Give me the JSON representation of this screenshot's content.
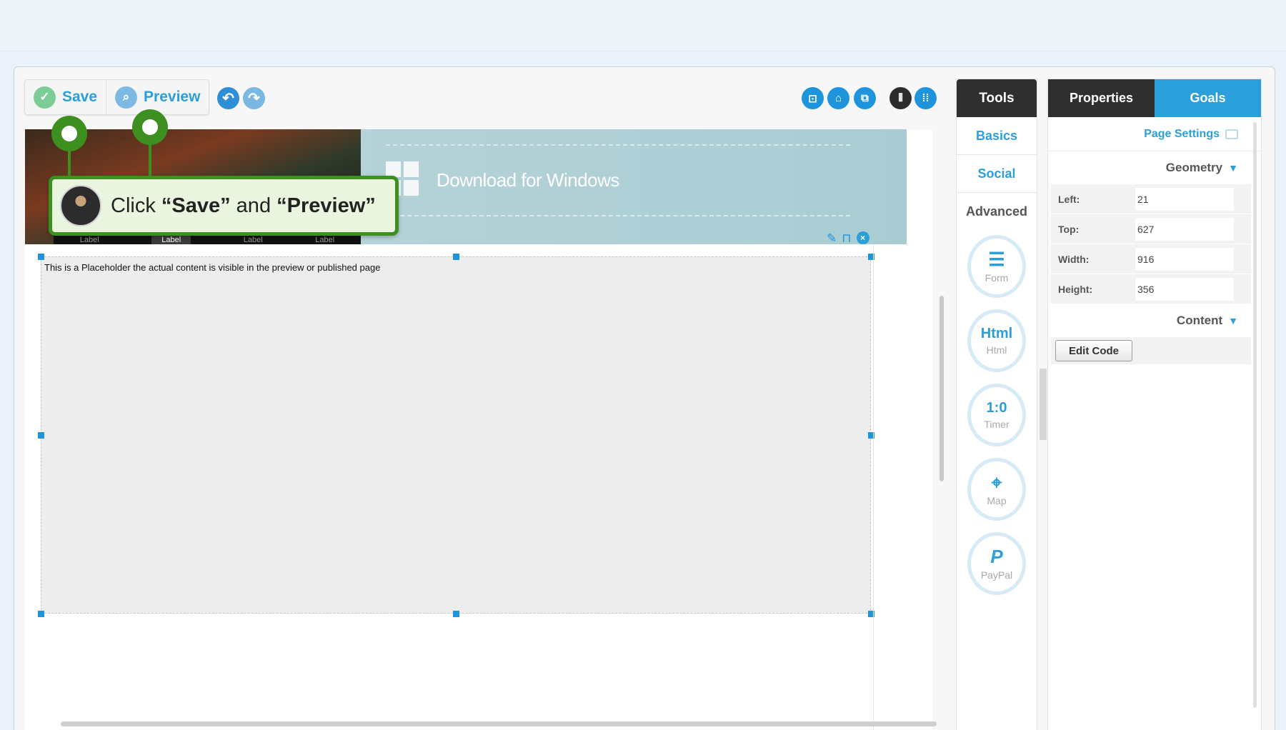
{
  "toolbar": {
    "save_label": "Save",
    "preview_label": "Preview"
  },
  "canvas": {
    "banner": {
      "download_text": "Download for Windows",
      "photo_tabs": [
        "Label",
        "Label",
        "Label",
        "Label"
      ]
    },
    "placeholder_text": "This is a Placeholder the actual content is visible in the preview or published page"
  },
  "tools_panel": {
    "title": "Tools",
    "tabs": [
      "Basics",
      "Social",
      "Advanced"
    ],
    "items": [
      {
        "label": "Form",
        "icon": "list-icon",
        "glyph": "☰"
      },
      {
        "label": "Html",
        "icon": "html-icon",
        "glyph": "Html"
      },
      {
        "label": "Timer",
        "icon": "timer-icon",
        "glyph": "1:0"
      },
      {
        "label": "Map",
        "icon": "map-icon",
        "glyph": "⌖"
      },
      {
        "label": "PayPal",
        "icon": "paypal-icon",
        "glyph": "P"
      }
    ]
  },
  "properties_panel": {
    "tabs": [
      "Properties",
      "Goals"
    ],
    "page_settings_label": "Page Settings",
    "geometry_label": "Geometry",
    "fields": [
      {
        "label": "Left:",
        "value": "21"
      },
      {
        "label": "Top:",
        "value": "627"
      },
      {
        "label": "Width:",
        "value": "916"
      },
      {
        "label": "Height:",
        "value": "356"
      }
    ],
    "content_label": "Content",
    "edit_code_label": "Edit Code"
  },
  "callout": {
    "prefix": "Click ",
    "first_action": "“Save”",
    "middle": " and ",
    "second_action": "“Preview”"
  },
  "colors": {
    "accent": "#2b9fd9",
    "dark": "#2f2f2f",
    "tutorial_green": "#3d9020"
  }
}
